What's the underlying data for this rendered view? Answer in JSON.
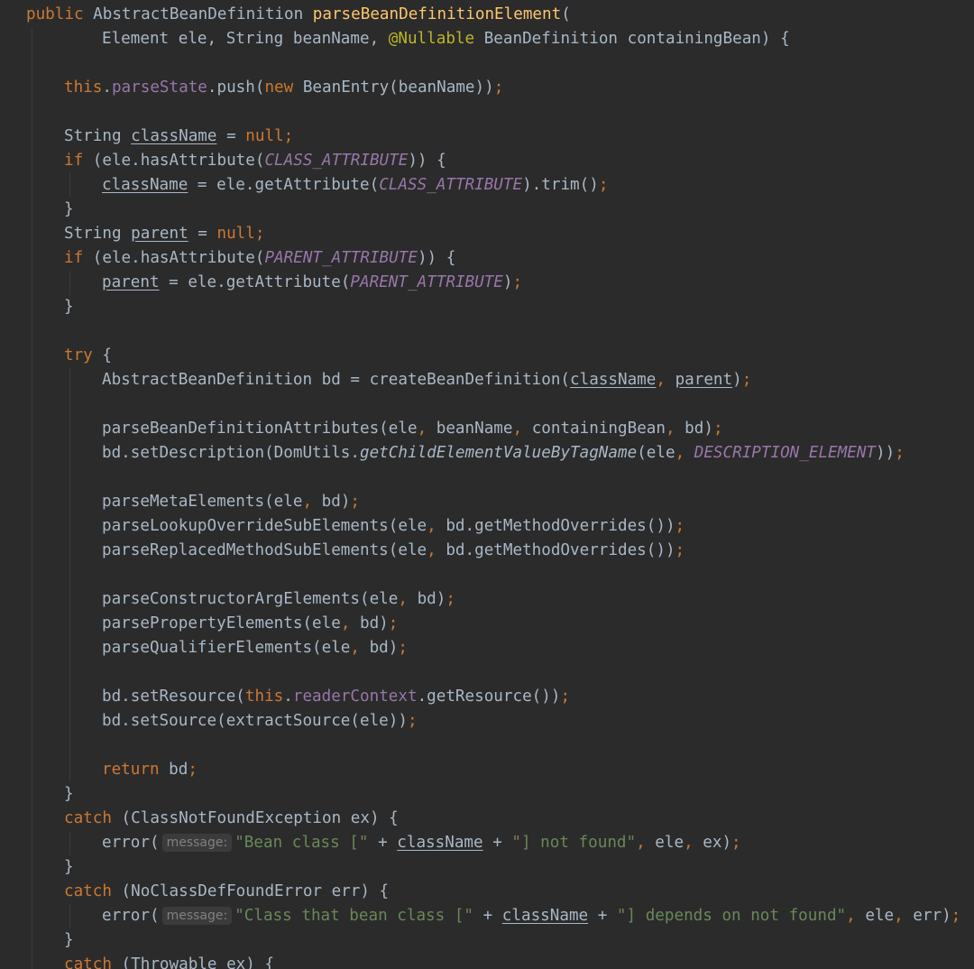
{
  "editor": {
    "theme": "darcula",
    "colors": {
      "background": "#2b2b2b",
      "text": "#a9b7c6",
      "keyword": "#cc7832",
      "method_declaration": "#ffc66d",
      "field": "#9876aa",
      "string": "#6a8759",
      "annotation": "#bbb529",
      "inlay_hint": "#808080"
    },
    "lines": [
      {
        "indent": 0,
        "tokens": [
          [
            "kw",
            "public"
          ],
          [
            "t",
            " AbstractBeanDefinition "
          ],
          [
            "fn",
            "parseBeanDefinitionElement"
          ],
          [
            "t",
            "("
          ]
        ]
      },
      {
        "indent": 2,
        "tokens": [
          [
            "t",
            "Element ele, String beanName, "
          ],
          [
            "ann",
            "@Nullable"
          ],
          [
            "t",
            " BeanDefinition containingBean) {"
          ]
        ]
      },
      {
        "indent": 0,
        "tokens": []
      },
      {
        "indent": 1,
        "tokens": [
          [
            "kw",
            "this"
          ],
          [
            "t",
            "."
          ],
          [
            "field",
            "parseState"
          ],
          [
            "t",
            ".push("
          ],
          [
            "kw",
            "new"
          ],
          [
            "t",
            " BeanEntry(beanName))"
          ],
          [
            "kw",
            ";"
          ]
        ]
      },
      {
        "indent": 0,
        "tokens": []
      },
      {
        "indent": 1,
        "tokens": [
          [
            "t",
            "String "
          ],
          [
            "var",
            "className"
          ],
          [
            "t",
            " = "
          ],
          [
            "kw",
            "null;"
          ]
        ]
      },
      {
        "indent": 1,
        "tokens": [
          [
            "kw",
            "if"
          ],
          [
            "t",
            " (ele.hasAttribute("
          ],
          [
            "const",
            "CLASS_ATTRIBUTE"
          ],
          [
            "t",
            ")) {"
          ]
        ]
      },
      {
        "indent": 2,
        "tokens": [
          [
            "var",
            "className"
          ],
          [
            "t",
            " = ele.getAttribute("
          ],
          [
            "const",
            "CLASS_ATTRIBUTE"
          ],
          [
            "t",
            ").trim()"
          ],
          [
            "kw",
            ";"
          ]
        ]
      },
      {
        "indent": 1,
        "tokens": [
          [
            "t",
            "}"
          ]
        ]
      },
      {
        "indent": 1,
        "tokens": [
          [
            "t",
            "String "
          ],
          [
            "var",
            "parent"
          ],
          [
            "t",
            " = "
          ],
          [
            "kw",
            "null;"
          ]
        ]
      },
      {
        "indent": 1,
        "tokens": [
          [
            "kw",
            "if"
          ],
          [
            "t",
            " (ele.hasAttribute("
          ],
          [
            "const",
            "PARENT_ATTRIBUTE"
          ],
          [
            "t",
            ")) {"
          ]
        ]
      },
      {
        "indent": 2,
        "tokens": [
          [
            "var",
            "parent"
          ],
          [
            "t",
            " = ele.getAttribute("
          ],
          [
            "const",
            "PARENT_ATTRIBUTE"
          ],
          [
            "t",
            ")"
          ],
          [
            "kw",
            ";"
          ]
        ]
      },
      {
        "indent": 1,
        "tokens": [
          [
            "t",
            "}"
          ]
        ]
      },
      {
        "indent": 0,
        "tokens": []
      },
      {
        "indent": 1,
        "tokens": [
          [
            "kw",
            "try"
          ],
          [
            "t",
            " {"
          ]
        ]
      },
      {
        "indent": 2,
        "tokens": [
          [
            "t",
            "AbstractBeanDefinition bd = createBeanDefinition("
          ],
          [
            "var",
            "className"
          ],
          [
            "kw",
            ", "
          ],
          [
            "var",
            "parent"
          ],
          [
            "t",
            ")"
          ],
          [
            "kw",
            ";"
          ]
        ]
      },
      {
        "indent": 0,
        "tokens": []
      },
      {
        "indent": 2,
        "tokens": [
          [
            "t",
            "parseBeanDefinitionAttributes(ele"
          ],
          [
            "kw",
            ", "
          ],
          [
            "t",
            "beanName"
          ],
          [
            "kw",
            ", "
          ],
          [
            "t",
            "containingBean"
          ],
          [
            "kw",
            ", "
          ],
          [
            "t",
            "bd)"
          ],
          [
            "kw",
            ";"
          ]
        ]
      },
      {
        "indent": 2,
        "tokens": [
          [
            "t",
            "bd.setDescription(DomUtils."
          ],
          [
            "static",
            "getChildElementValueByTagName"
          ],
          [
            "t",
            "(ele"
          ],
          [
            "kw",
            ", "
          ],
          [
            "const",
            "DESCRIPTION_ELEMENT"
          ],
          [
            "t",
            "))"
          ],
          [
            "kw",
            ";"
          ]
        ]
      },
      {
        "indent": 0,
        "tokens": []
      },
      {
        "indent": 2,
        "tokens": [
          [
            "t",
            "parseMetaElements(ele"
          ],
          [
            "kw",
            ", "
          ],
          [
            "t",
            "bd)"
          ],
          [
            "kw",
            ";"
          ]
        ]
      },
      {
        "indent": 2,
        "tokens": [
          [
            "t",
            "parseLookupOverrideSubElements(ele"
          ],
          [
            "kw",
            ", "
          ],
          [
            "t",
            "bd.getMethodOverrides())"
          ],
          [
            "kw",
            ";"
          ]
        ]
      },
      {
        "indent": 2,
        "tokens": [
          [
            "t",
            "parseReplacedMethodSubElements(ele"
          ],
          [
            "kw",
            ", "
          ],
          [
            "t",
            "bd.getMethodOverrides())"
          ],
          [
            "kw",
            ";"
          ]
        ]
      },
      {
        "indent": 0,
        "tokens": []
      },
      {
        "indent": 2,
        "tokens": [
          [
            "t",
            "parseConstructorArgElements(ele"
          ],
          [
            "kw",
            ", "
          ],
          [
            "t",
            "bd)"
          ],
          [
            "kw",
            ";"
          ]
        ]
      },
      {
        "indent": 2,
        "tokens": [
          [
            "t",
            "parsePropertyElements(ele"
          ],
          [
            "kw",
            ", "
          ],
          [
            "t",
            "bd)"
          ],
          [
            "kw",
            ";"
          ]
        ]
      },
      {
        "indent": 2,
        "tokens": [
          [
            "t",
            "parseQualifierElements(ele"
          ],
          [
            "kw",
            ", "
          ],
          [
            "t",
            "bd)"
          ],
          [
            "kw",
            ";"
          ]
        ]
      },
      {
        "indent": 0,
        "tokens": []
      },
      {
        "indent": 2,
        "tokens": [
          [
            "t",
            "bd.setResource("
          ],
          [
            "kw",
            "this"
          ],
          [
            "t",
            "."
          ],
          [
            "field",
            "readerContext"
          ],
          [
            "t",
            ".getResource())"
          ],
          [
            "kw",
            ";"
          ]
        ]
      },
      {
        "indent": 2,
        "tokens": [
          [
            "t",
            "bd.setSource(extractSource(ele))"
          ],
          [
            "kw",
            ";"
          ]
        ]
      },
      {
        "indent": 0,
        "tokens": []
      },
      {
        "indent": 2,
        "tokens": [
          [
            "kw",
            "return"
          ],
          [
            "t",
            " bd"
          ],
          [
            "kw",
            ";"
          ]
        ]
      },
      {
        "indent": 1,
        "tokens": [
          [
            "t",
            "}"
          ]
        ]
      },
      {
        "indent": 1,
        "tokens": [
          [
            "kw",
            "catch"
          ],
          [
            "t",
            " (ClassNotFoundException ex) {"
          ]
        ]
      },
      {
        "indent": 2,
        "tokens": [
          [
            "t",
            "error("
          ],
          [
            "hint",
            "message:"
          ],
          [
            "str",
            "\"Bean class [\""
          ],
          [
            "t",
            " + "
          ],
          [
            "var",
            "className"
          ],
          [
            "t",
            " + "
          ],
          [
            "str",
            "\"] not found\""
          ],
          [
            "kw",
            ", "
          ],
          [
            "t",
            "ele"
          ],
          [
            "kw",
            ", "
          ],
          [
            "t",
            "ex)"
          ],
          [
            "kw",
            ";"
          ]
        ]
      },
      {
        "indent": 1,
        "tokens": [
          [
            "t",
            "}"
          ]
        ]
      },
      {
        "indent": 1,
        "tokens": [
          [
            "kw",
            "catch"
          ],
          [
            "t",
            " (NoClassDefFoundError err) {"
          ]
        ]
      },
      {
        "indent": 2,
        "tokens": [
          [
            "t",
            "error("
          ],
          [
            "hint",
            "message:"
          ],
          [
            "str",
            "\"Class that bean class [\""
          ],
          [
            "t",
            " + "
          ],
          [
            "var",
            "className"
          ],
          [
            "t",
            " + "
          ],
          [
            "str",
            "\"] depends on not found\""
          ],
          [
            "kw",
            ", "
          ],
          [
            "t",
            "ele"
          ],
          [
            "kw",
            ", "
          ],
          [
            "t",
            "err)"
          ],
          [
            "kw",
            ";"
          ]
        ]
      },
      {
        "indent": 1,
        "tokens": [
          [
            "t",
            "}"
          ]
        ]
      },
      {
        "indent": 1,
        "tokens": [
          [
            "kw",
            "catch"
          ],
          [
            "t",
            " (Throwable ex) {"
          ]
        ]
      }
    ]
  }
}
